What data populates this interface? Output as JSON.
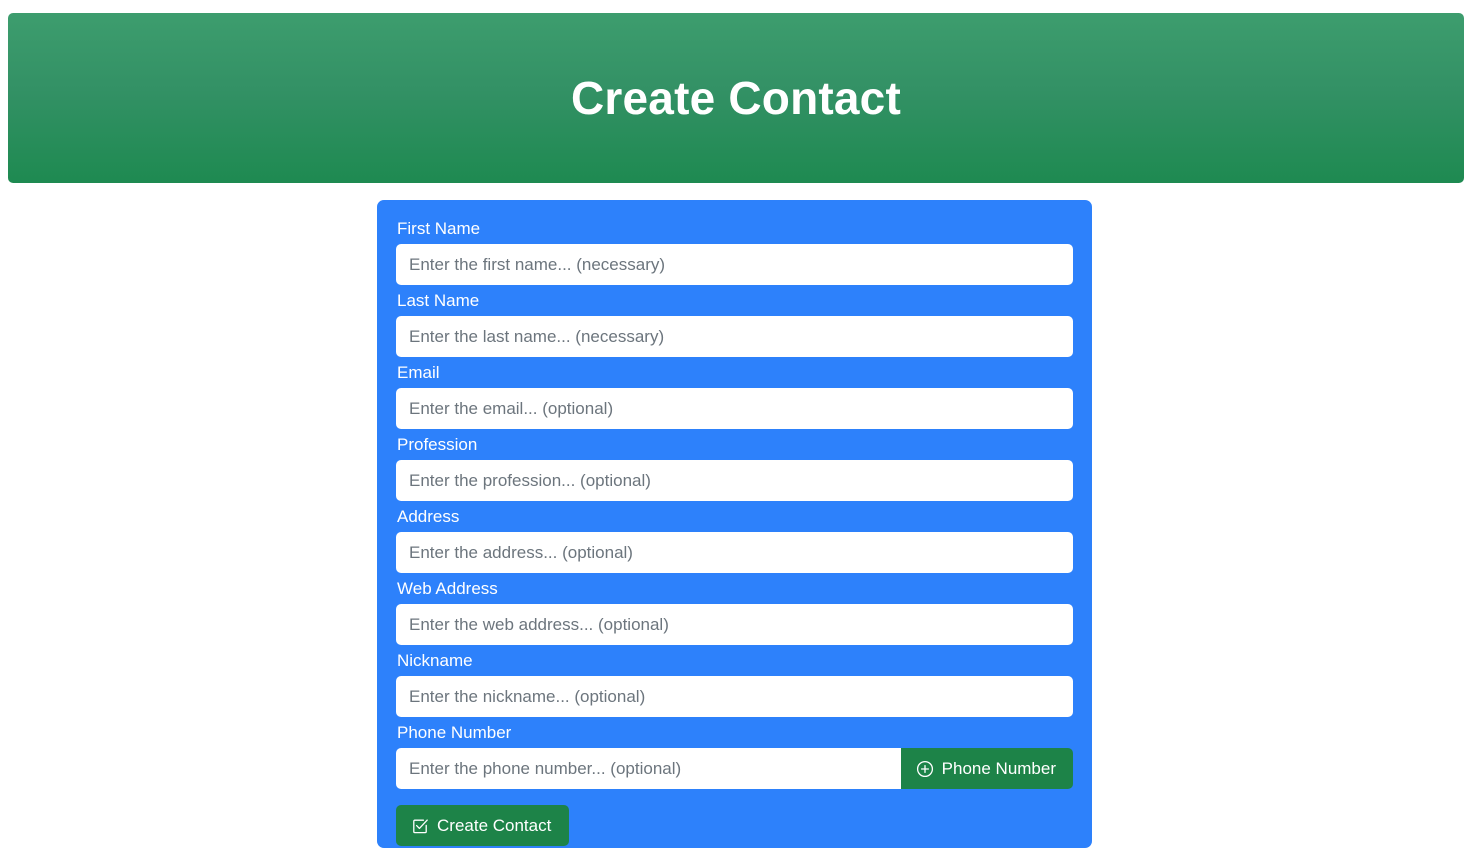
{
  "page": {
    "background_color": "#ffffff"
  },
  "header": {
    "title": "Create Contact",
    "gradient_from": "#3d9d6e",
    "gradient_to": "#1e8a51",
    "text_color": "#ffffff"
  },
  "form": {
    "card_color": "#2d81fb",
    "fields": [
      {
        "label": "First Name",
        "placeholder": "Enter the first name... (necessary)",
        "value": ""
      },
      {
        "label": "Last Name",
        "placeholder": "Enter the last name... (necessary)",
        "value": ""
      },
      {
        "label": "Email",
        "placeholder": "Enter the email... (optional)",
        "value": ""
      },
      {
        "label": "Profession",
        "placeholder": "Enter the profession... (optional)",
        "value": ""
      },
      {
        "label": "Address",
        "placeholder": "Enter the address... (optional)",
        "value": ""
      },
      {
        "label": "Web Address",
        "placeholder": "Enter the web address... (optional)",
        "value": ""
      },
      {
        "label": "Nickname",
        "placeholder": "Enter the nickname... (optional)",
        "value": ""
      }
    ],
    "phone": {
      "label": "Phone Number",
      "placeholder": "Enter the phone number... (optional)",
      "value": "",
      "add_button_label": "Phone Number",
      "add_button_icon": "plus-circle-icon"
    },
    "submit": {
      "label": "Create Contact",
      "icon": "check-square-icon",
      "color": "#1d8348"
    }
  }
}
